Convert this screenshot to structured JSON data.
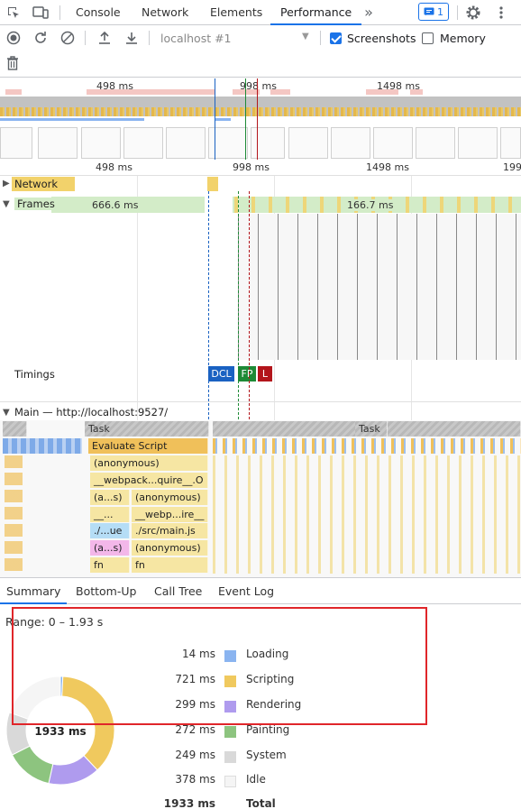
{
  "tabs": [
    "Console",
    "Network",
    "Elements",
    "Performance"
  ],
  "active_tab": "Performance",
  "issues_badge": "1",
  "toolbar": {
    "target": "localhost #1",
    "screenshots_label": "Screenshots",
    "screenshots_checked": true,
    "memory_label": "Memory",
    "memory_checked": false
  },
  "overview_ticks": [
    "498 ms",
    "998 ms",
    "1498 ms"
  ],
  "ruler_ticks": [
    "498 ms",
    "998 ms",
    "1498 ms",
    "199"
  ],
  "tracks": {
    "network": "Network",
    "frames": "Frames",
    "frame_label_1": "666.6 ms",
    "frame_label_2": "166.7 ms",
    "timings": "Timings",
    "main": "Main — http://localhost:9527/"
  },
  "timing_markers": [
    {
      "label": "DCL",
      "color": "#1a62c2"
    },
    {
      "label": "FP",
      "color": "#1e8a36"
    },
    {
      "label": "L",
      "color": "#b3151b"
    }
  ],
  "flame": {
    "task1": "Task",
    "task2": "Task",
    "evaluate": "Evaluate Script",
    "anon1": "(anonymous)",
    "webpack1": "__webpack...quire__.O",
    "as1": "(a...s)",
    "anon2": "(anonymous)",
    "dash": "__...",
    "webpack2": "__webp...ire__",
    "ue": "./...ue",
    "mainjs": "./src/main.js",
    "as2": "(a...s)",
    "anon3": "(anonymous)",
    "fn1": "fn",
    "fn2": "fn"
  },
  "bottom_tabs": [
    "Summary",
    "Bottom-Up",
    "Call Tree",
    "Event Log"
  ],
  "active_bottom_tab": "Summary",
  "summary": {
    "range": "Range: 0 – 1.93 s",
    "total_ms": "1933 ms",
    "rows": [
      {
        "value": "14 ms",
        "label": "Loading",
        "color": "#8ab4f0"
      },
      {
        "value": "721 ms",
        "label": "Scripting",
        "color": "#f0c95e"
      },
      {
        "value": "299 ms",
        "label": "Rendering",
        "color": "#af9bee"
      },
      {
        "value": "272 ms",
        "label": "Painting",
        "color": "#8dc47f"
      },
      {
        "value": "249 ms",
        "label": "System",
        "color": "#d9d9d9"
      },
      {
        "value": "378 ms",
        "label": "Idle",
        "color": "#f5f5f5"
      },
      {
        "value": "1933 ms",
        "label": "Total",
        "color": ""
      }
    ]
  }
}
